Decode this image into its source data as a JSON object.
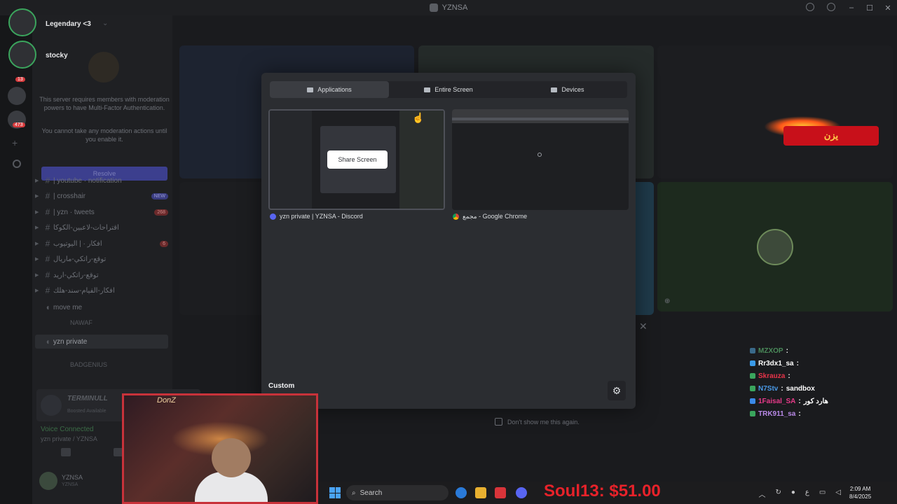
{
  "window": {
    "title": "YZNSA"
  },
  "streams": [
    {
      "name": "Legendary <3"
    },
    {
      "name": "stocky"
    }
  ],
  "server": {
    "mfa_line1": "This server requires members with moderation powers to have Multi-Factor Authentication.",
    "mfa_line2": "You cannot take any moderation actions until you enable it.",
    "resolve_label": "Resolve",
    "rail_badges": [
      "13",
      "473"
    ]
  },
  "channels": [
    {
      "name": "| youtube · notification",
      "badge": ""
    },
    {
      "name": "| crosshair",
      "badge": "NEW"
    },
    {
      "name": "| yzn · tweets",
      "badge": "268"
    },
    {
      "name": "اقتراحات-لاعبين-الكوكا",
      "badge": ""
    },
    {
      "name": "افكار · | اليوتيوب",
      "badge": "6"
    },
    {
      "name": "توقع-راتكي-ماريال",
      "badge": ""
    },
    {
      "name": "توقع-راتكي-اريد",
      "badge": ""
    },
    {
      "name": "افكار-الفيام-سند-هلك",
      "badge": ""
    },
    {
      "name": "move me",
      "badge": ""
    }
  ],
  "voice": {
    "user1": "NAWAF",
    "channel": "yzn private",
    "user2": "BADGENIUS",
    "panel_title": "TERMINULL",
    "panel_sub": "Boosted Available",
    "status": "Voice Connected",
    "status_sub": "yzn private / YZNSA",
    "user_name": "YZNSA",
    "user_sub": "YZNSA"
  },
  "modal": {
    "tabs": [
      {
        "label": "Applications",
        "active": true
      },
      {
        "label": "Entire Screen",
        "active": false
      },
      {
        "label": "Devices",
        "active": false
      }
    ],
    "share_button": "Share Screen",
    "sources": [
      {
        "label": "yzn private | YZNSA - Discord"
      },
      {
        "label": "مجمع - Google Chrome"
      }
    ],
    "custom_label": "Custom",
    "dont_show": "Don't show me this again."
  },
  "banner_text": "يزن",
  "chat": [
    {
      "user": "MZXOP",
      "msg": "",
      "color": "#4a8a5a"
    },
    {
      "user": "Rr3dx1_sa",
      "msg": "",
      "color": "#ffffff"
    },
    {
      "user": "Skrauza",
      "msg": "",
      "color": "#e8344a"
    },
    {
      "user": "N7Stv",
      "msg": "sandbox",
      "color": "#4a9ae8"
    },
    {
      "user": "1Faisal_SA",
      "msg": "هارد كور",
      "color": "#e83a8a"
    },
    {
      "user": "TRK911_sa",
      "msg": "",
      "color": "#b98ae8"
    }
  ],
  "cam": {
    "signature": "DonZ"
  },
  "taskbar": {
    "search_label": "Search",
    "donation": "Soul13: $51.00",
    "time": "2:09 AM",
    "date": "8/4/2025"
  }
}
